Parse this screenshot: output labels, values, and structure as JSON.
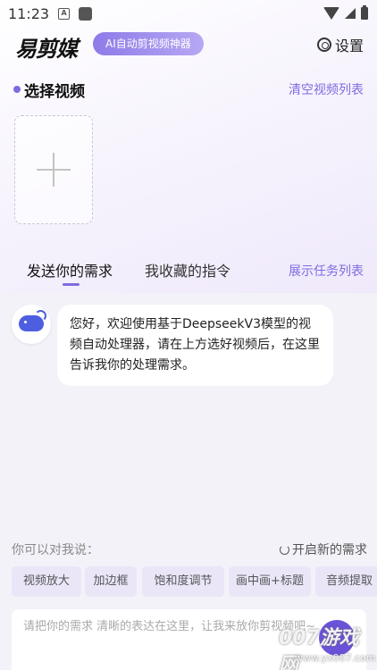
{
  "status_bar": {
    "time": "11:23",
    "notif_icon": "A"
  },
  "header": {
    "logo": "易剪媒",
    "badge": "AI自动剪视频神器",
    "settings_label": "设置"
  },
  "video_section": {
    "title": "选择视频",
    "clear_label": "清空视频列表"
  },
  "tabs": [
    {
      "label": "发送你的需求",
      "active": true
    },
    {
      "label": "我收藏的指令",
      "active": false
    }
  ],
  "show_tasks_label": "展示任务列表",
  "chat": {
    "messages": [
      {
        "from": "bot",
        "text": "您好，欢迎使用基于DeepseekV3模型的视频自动处理器，请在上方选好视频后，在这里告诉我你的处理需求。"
      }
    ]
  },
  "suggestions": {
    "hint": "你可以对我说：",
    "restart_label": "开启新的需求",
    "chips": [
      "视频放大",
      "加边框",
      "饱和度调节",
      "画中画+标题",
      "音频提取"
    ]
  },
  "input": {
    "placeholder": "请把你的需求 清晰的表达在这里，让我来放你剪视频吧~"
  },
  "watermark": {
    "main": "007游戏网",
    "sub": "www.yx007.com"
  },
  "colors": {
    "accent": "#7f6be0",
    "badge_gradient_start": "#8f7be8",
    "page_bg": "#f3f2f9",
    "chip_bg": "#eae6f8"
  }
}
